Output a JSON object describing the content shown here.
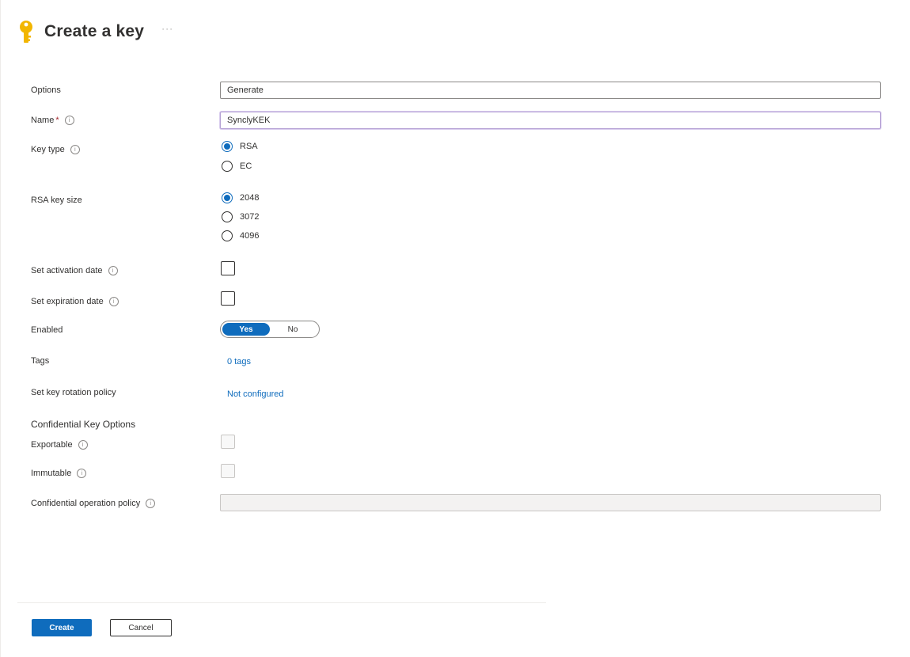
{
  "header": {
    "title": "Create a key",
    "more": "···"
  },
  "form": {
    "options": {
      "label": "Options",
      "value": "Generate"
    },
    "name": {
      "label": "Name",
      "required_mark": "*",
      "value": "SynclyKEK"
    },
    "key_type": {
      "label": "Key type",
      "choices": [
        {
          "label": "RSA",
          "selected": true
        },
        {
          "label": "EC",
          "selected": false
        }
      ]
    },
    "rsa_key_size": {
      "label": "RSA key size",
      "choices": [
        {
          "label": "2048",
          "selected": true
        },
        {
          "label": "3072",
          "selected": false
        },
        {
          "label": "4096",
          "selected": false
        }
      ]
    },
    "activation_date": {
      "label": "Set activation date",
      "checked": false
    },
    "expiration_date": {
      "label": "Set expiration date",
      "checked": false
    },
    "enabled": {
      "label": "Enabled",
      "on_label": "Yes",
      "off_label": "No",
      "value": "Yes"
    },
    "tags": {
      "label": "Tags",
      "link": "0 tags"
    },
    "rotation_policy": {
      "label": "Set key rotation policy",
      "link": "Not configured"
    },
    "confidential": {
      "section_title": "Confidential Key Options",
      "exportable": {
        "label": "Exportable",
        "checked": false,
        "disabled": true
      },
      "immutable": {
        "label": "Immutable",
        "checked": false,
        "disabled": true
      },
      "operation_policy": {
        "label": "Confidential operation policy",
        "value": ""
      }
    }
  },
  "footer": {
    "create_label": "Create",
    "cancel_label": "Cancel"
  },
  "colors": {
    "accent": "#0f6cbd",
    "key_icon": "#f2b600",
    "required": "#a4262c"
  },
  "icons": [
    "key-icon",
    "info-icon",
    "more-icon"
  ]
}
